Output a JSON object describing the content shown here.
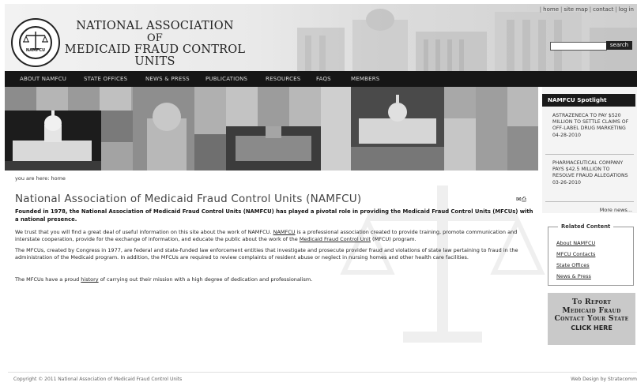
{
  "header": {
    "org_line1": "NATIONAL ASSOCIATION",
    "org_line2": "OF",
    "org_line3": "MEDICAID FRAUD CONTROL UNITS",
    "seal_text": "NAMFCU",
    "utility_links": [
      "home",
      "site map",
      "contact",
      "log in"
    ],
    "search_placeholder": "",
    "search_label": "search"
  },
  "nav": {
    "items": [
      "ABOUT NAMFCU",
      "STATE OFFICES",
      "NEWS & PRESS",
      "PUBLICATIONS",
      "RESOURCES",
      "FAQS",
      "MEMBERS"
    ]
  },
  "breadcrumb": "you are here: home",
  "main": {
    "title": "National Association of Medicaid Fraud Control Units (NAMFCU)",
    "intro": "Founded in 1978, the National Association of Medicaid Fraud Control Units (NAMFCU) has played a pivotal role in providing the Medicaid Fraud Control Units (MFCUs) with a national presence.",
    "p1_a": "We trust that you will find a great deal of useful information on this site about the work of NAMFCU. ",
    "p1_link1": "NAMFCU",
    "p1_b": " is a professional association created to provide training, promote communication and interstate cooperation, provide for the exchange of information, and educate the public about the work of the ",
    "p1_link2": "Medicaid Fraud Control Unit",
    "p1_c": " (MFCU) program.",
    "p2": "The MFCUs, created by Congress in 1977, are federal and state-funded law enforcement entities that investigate and prosecute provider fraud and violations of state law pertaining to fraud in the administration of the Medicaid program. In addition, the MFCUs are required to review complaints of resident abuse or neglect in nursing homes and other health care facilities.",
    "p3_a": "The MFCUs have a proud ",
    "p3_link": "history",
    "p3_b": " of carrying out their mission with a high degree of dedication and professionalism."
  },
  "sidebar": {
    "spotlight_title": "NAMFCU Spotlight",
    "news": [
      {
        "text": "ASTRAZENECA TO PAY $520 MILLION TO SETTLE CLAIMS OF OFF-LABEL DRUG MARKETING",
        "date": "04-28-2010"
      },
      {
        "text": "PHARMACEUTICAL COMPANY PAYS $42.5 MILLION TO RESOLVE FRAUD ALLEGATIONS",
        "date": "03-26-2010"
      }
    ],
    "more_news": "More news...",
    "related_title": "Related Content",
    "related_links": [
      "About NAMFCU",
      "MFCU Contacts",
      "State Offices",
      "News & Press"
    ],
    "report_lines": [
      "To Report",
      "Medicaid Fraud",
      "Contact Your State"
    ],
    "report_click": "CLICK HERE"
  },
  "footer": {
    "copyright": "Copyright © 2011 National Association of Medicaid Fraud Control Units",
    "credit": "Web Design by Stratecomm"
  }
}
